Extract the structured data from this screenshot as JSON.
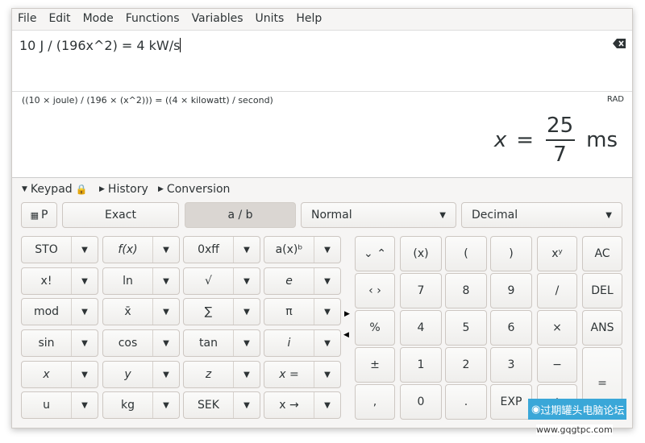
{
  "menu": [
    "File",
    "Edit",
    "Mode",
    "Functions",
    "Variables",
    "Units",
    "Help"
  ],
  "expression": "10 J / (196x^2) = 4 kW/s",
  "parsed": "((10 × joule) / (196 × (x^2))) = ((4 × kilowatt) / second)",
  "angle_mode": "RAD",
  "result": {
    "var": "x",
    "eq": "=",
    "numerator": "25",
    "denominator": "7",
    "unit": "ms"
  },
  "expanders": {
    "keypad": "Keypad",
    "history": "History",
    "conversion": "Conversion"
  },
  "toolbar": {
    "p": "P",
    "exact": "Exact",
    "fraction": "a / b",
    "fraction_pressed": true,
    "format": "Normal",
    "base": "Decimal"
  },
  "left_keys": [
    [
      "STO",
      "f(x)",
      "0xff",
      "a(x)ᵇ"
    ],
    [
      "x!",
      "ln",
      "√",
      "e"
    ],
    [
      "mod",
      "x̄",
      "∑",
      "π"
    ],
    [
      "sin",
      "cos",
      "tan",
      "i"
    ],
    [
      "x",
      "y",
      "z",
      "x ="
    ],
    [
      "u",
      "kg",
      "SEK",
      "x →"
    ]
  ],
  "right_keys": [
    [
      "(x)",
      "(",
      ")",
      "xʸ",
      "AC"
    ],
    [
      "7",
      "8",
      "9",
      "/",
      "DEL"
    ],
    [
      "4",
      "5",
      "6",
      "×",
      "ANS"
    ],
    [
      "1",
      "2",
      "3",
      "−",
      "="
    ],
    [
      "0",
      ".",
      "EXP",
      "+"
    ]
  ],
  "nav_keys": [
    "⌄ ⌃",
    "‹ ›",
    "%",
    "±",
    ","
  ],
  "watermark": {
    "name": "过期罐头电脑论坛",
    "url": "www.gqgtpc.com"
  }
}
